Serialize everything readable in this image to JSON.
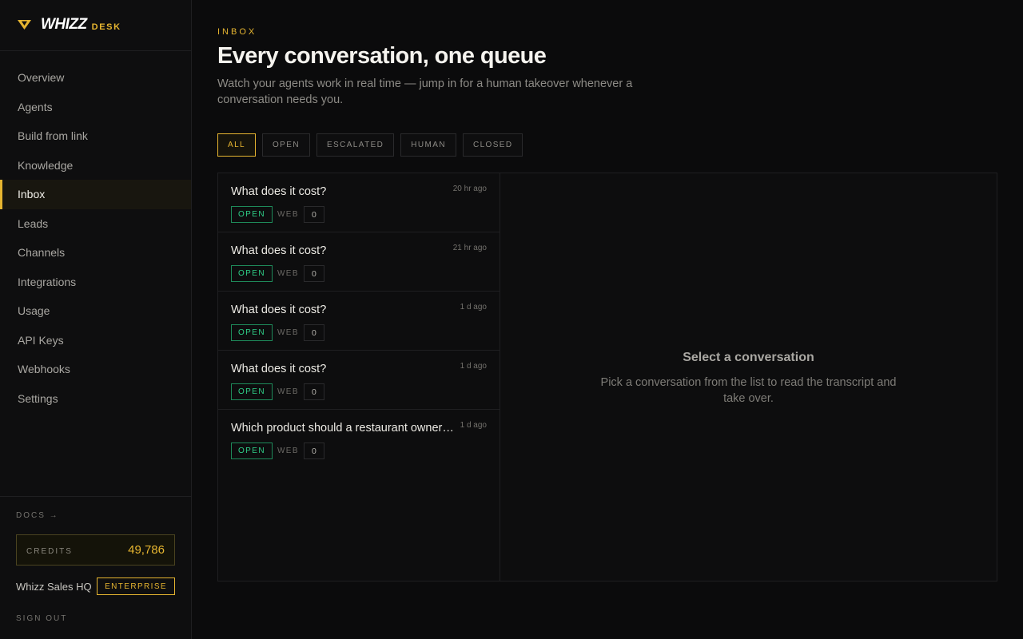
{
  "brand": {
    "name": "WHIZZ",
    "sub": "DESK",
    "accent": "#e6b530"
  },
  "sidebar": {
    "items": [
      {
        "label": "Overview",
        "active": false
      },
      {
        "label": "Agents",
        "active": false
      },
      {
        "label": "Build from link",
        "active": false
      },
      {
        "label": "Knowledge",
        "active": false
      },
      {
        "label": "Inbox",
        "active": true
      },
      {
        "label": "Leads",
        "active": false
      },
      {
        "label": "Channels",
        "active": false
      },
      {
        "label": "Integrations",
        "active": false
      },
      {
        "label": "Usage",
        "active": false
      },
      {
        "label": "API Keys",
        "active": false
      },
      {
        "label": "Webhooks",
        "active": false
      },
      {
        "label": "Settings",
        "active": false
      }
    ],
    "docs_label": "DOCS →",
    "credits_label": "CREDITS",
    "credits_value": "49,786",
    "workspace_name": "Whizz Sales HQ",
    "plan_badge": "ENTERPRISE",
    "signout_label": "SIGN OUT"
  },
  "header": {
    "eyebrow": "INBOX",
    "title": "Every conversation, one queue",
    "subtitle": "Watch your agents work in real time — jump in for a human takeover whenever a conversation needs you."
  },
  "filters": [
    {
      "label": "ALL",
      "active": true
    },
    {
      "label": "OPEN",
      "active": false
    },
    {
      "label": "ESCALATED",
      "active": false
    },
    {
      "label": "HUMAN",
      "active": false
    },
    {
      "label": "CLOSED",
      "active": false
    }
  ],
  "conversations": [
    {
      "title": "What does it cost?",
      "time": "20 hr ago",
      "status": "OPEN",
      "channel": "WEB",
      "count": "0"
    },
    {
      "title": "What does it cost?",
      "time": "21 hr ago",
      "status": "OPEN",
      "channel": "WEB",
      "count": "0"
    },
    {
      "title": "What does it cost?",
      "time": "1 d ago",
      "status": "OPEN",
      "channel": "WEB",
      "count": "0"
    },
    {
      "title": "What does it cost?",
      "time": "1 d ago",
      "status": "OPEN",
      "channel": "WEB",
      "count": "0"
    },
    {
      "title": "Which product should a restaurant owner choose?",
      "time": "1 d ago",
      "status": "OPEN",
      "channel": "WEB",
      "count": "0"
    }
  ],
  "detail": {
    "empty_title": "Select a conversation",
    "empty_subtitle": "Pick a conversation from the list to read the transcript and take over."
  },
  "colors": {
    "status_open": "#2fcf88",
    "background": "#0b0b0c"
  }
}
